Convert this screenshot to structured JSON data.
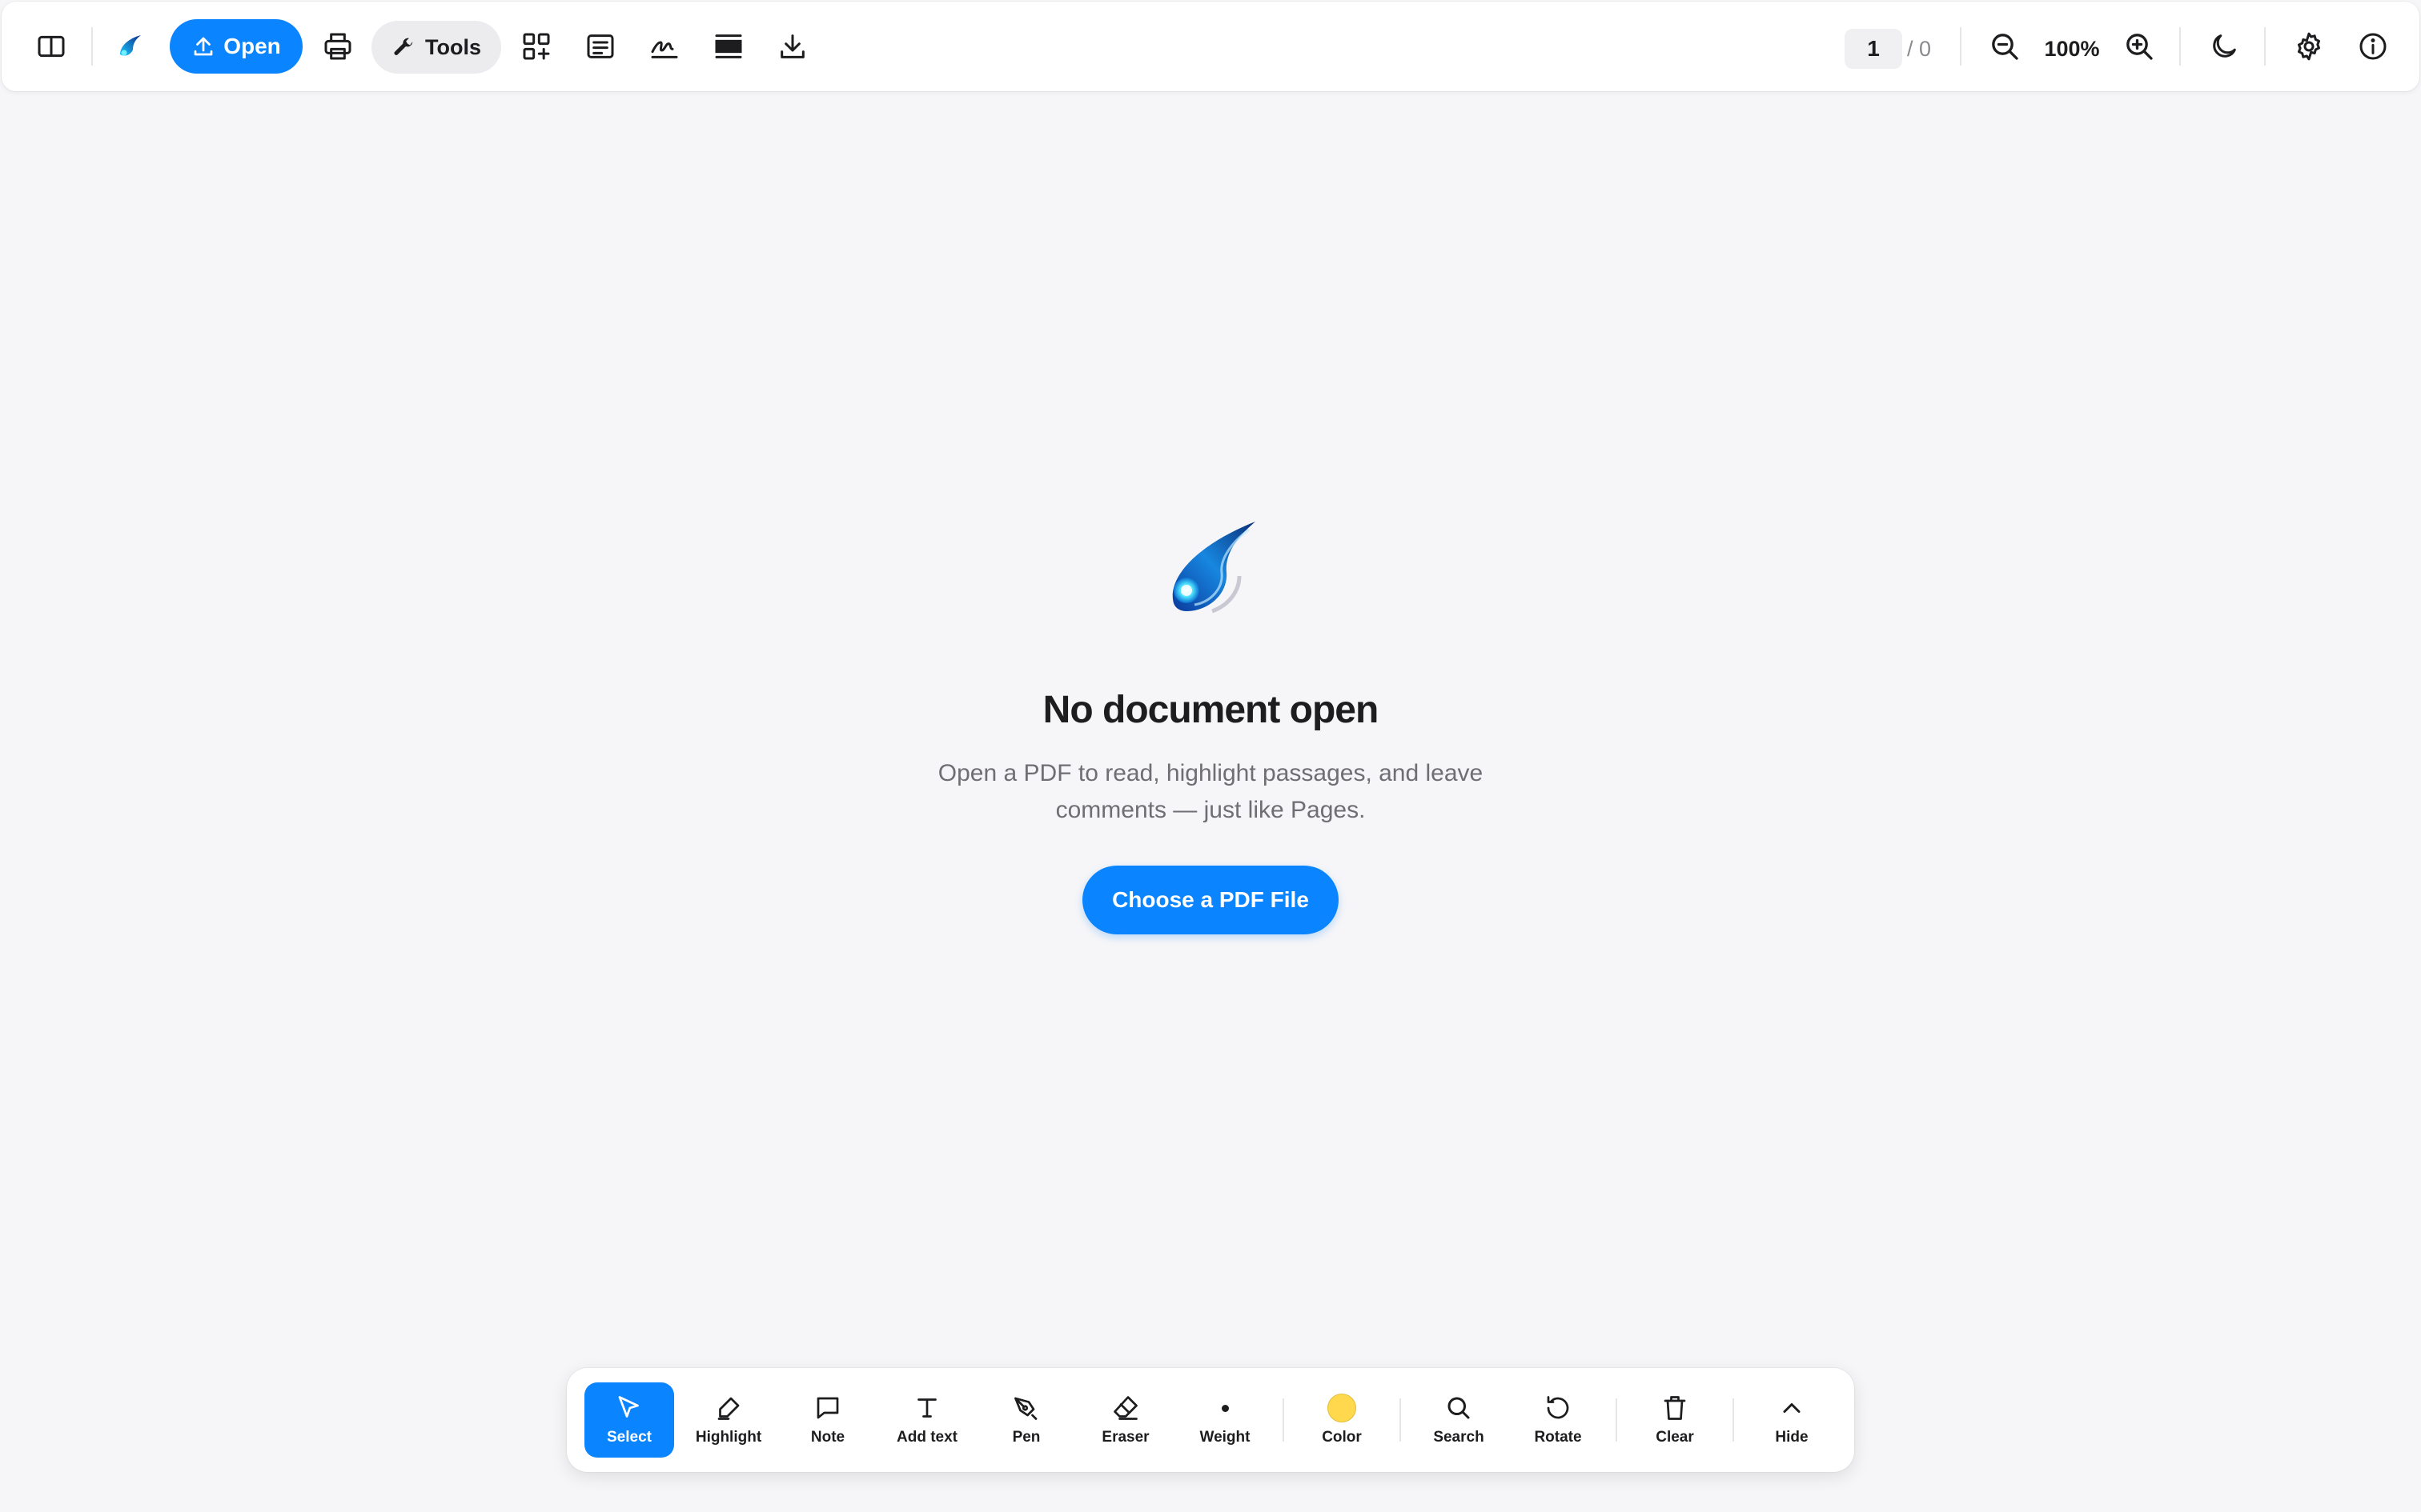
{
  "toolbar": {
    "open_label": "Open",
    "tools_label": "Tools",
    "page_current": "1",
    "page_total": "/ 0",
    "zoom_level": "100%"
  },
  "empty_state": {
    "title": "No document open",
    "subtitle": "Open a PDF to read, highlight passages, and leave comments — just like Pages.",
    "button_label": "Choose a PDF File"
  },
  "dock": {
    "items": [
      {
        "label": "Select",
        "icon": "cursor-arrow-icon",
        "active": true
      },
      {
        "label": "Highlight",
        "icon": "highlighter-icon"
      },
      {
        "label": "Note",
        "icon": "speech-bubble-icon"
      },
      {
        "label": "Add text",
        "icon": "text-cursor-icon"
      },
      {
        "label": "Pen",
        "icon": "pen-nib-icon"
      },
      {
        "label": "Eraser",
        "icon": "eraser-icon"
      },
      {
        "label": "Weight",
        "icon": "dot-icon"
      },
      {
        "label": "Color",
        "icon": "color-swatch"
      },
      {
        "label": "Search",
        "icon": "magnifier-icon"
      },
      {
        "label": "Rotate",
        "icon": "rotate-icon"
      },
      {
        "label": "Clear",
        "icon": "trash-icon"
      },
      {
        "label": "Hide",
        "icon": "chevron-up-icon"
      }
    ]
  },
  "colors": {
    "accent": "#0b84ff",
    "background": "#f6f6f8",
    "annotation_color": "#ffd84d"
  }
}
